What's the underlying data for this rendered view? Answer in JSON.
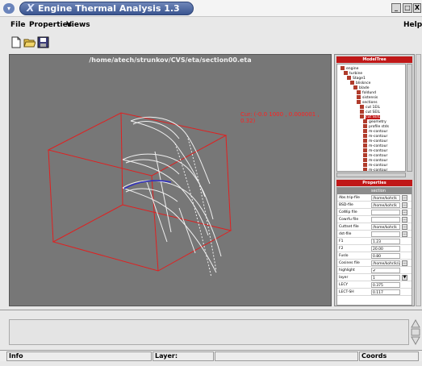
{
  "window": {
    "title": "Engine Thermal Analysis 1.3",
    "logo_glyph": "X",
    "controls": [
      "_",
      "□",
      "X"
    ]
  },
  "menu": {
    "file": "File",
    "properties": "Properties",
    "views": "Views",
    "help": "Help"
  },
  "toolbar": {
    "icons": [
      "new-file-icon",
      "open-folder-icon",
      "save-icon"
    ]
  },
  "viewport": {
    "path": "/home/atech/strunkov/CVS/eta/section00.eta",
    "coord_readout": "Cur: (-0.0 1000 , 0.000001  , 0.32)",
    "colors": {
      "background": "#777777",
      "box": "#e02020",
      "blade": "#f0f0f0",
      "highlight": "#3030c0"
    }
  },
  "model_tree": {
    "header": "ModelTree",
    "nodes": [
      {
        "label": "engine",
        "level": 0
      },
      {
        "label": "turbine",
        "level": 1
      },
      {
        "label": "Stage1",
        "level": 2
      },
      {
        "label": "blisknce",
        "level": 3
      },
      {
        "label": "blade",
        "level": 4
      },
      {
        "label": "foldund",
        "level": 5
      },
      {
        "label": "sistensis",
        "level": 5
      },
      {
        "label": "sections",
        "level": 5
      },
      {
        "label": "cut 1EIL",
        "level": 6
      },
      {
        "label": "cut SEIL",
        "level": 6
      },
      {
        "label": "cut SEIL",
        "level": 6,
        "selected": true
      },
      {
        "label": "geometry",
        "level": 7
      },
      {
        "label": "profile stds",
        "level": 7
      },
      {
        "label": "m-contour",
        "level": 7
      },
      {
        "label": "m-contour",
        "level": 7
      },
      {
        "label": "m-contour",
        "level": 7
      },
      {
        "label": "m-contour",
        "level": 7
      },
      {
        "label": "m-contour",
        "level": 7
      },
      {
        "label": "m-contour",
        "level": 7
      },
      {
        "label": "m-contour",
        "level": 7
      },
      {
        "label": "m-contour",
        "level": 7
      },
      {
        "label": "m-contour",
        "level": 7
      }
    ]
  },
  "properties": {
    "header": "Properties",
    "section": "section",
    "rows": [
      {
        "key": "Abs.trip-file",
        "value": "/home/kohr/k",
        "button": "..."
      },
      {
        "key": "BSD-file",
        "value": "/home/kohr/k",
        "button": "..."
      },
      {
        "key": "CoWip file",
        "value": "",
        "button": "..."
      },
      {
        "key": "Cowrfu file",
        "value": "",
        "button": "..."
      },
      {
        "key": "Cuttset file",
        "value": "/home/kohr/k",
        "button": "..."
      },
      {
        "key": "dst-file",
        "value": "",
        "button": "..."
      },
      {
        "key": "F1",
        "value": "1.23",
        "button": ""
      },
      {
        "key": "F2",
        "value": "20.00",
        "button": ""
      },
      {
        "key": "Fuslo",
        "value": "0.80",
        "button": ""
      },
      {
        "key": "Cosines file",
        "value": "/home/kohr/k/v",
        "button": "..."
      },
      {
        "key": "highlight",
        "value": "✔",
        "button": ""
      },
      {
        "key": "layer",
        "value": "1",
        "button": "▼"
      },
      {
        "key": "LECY",
        "value": "0.375",
        "button": ""
      },
      {
        "key": "LECT-SH",
        "value": "0.117",
        "button": ""
      }
    ]
  },
  "status": {
    "info": "Info",
    "layer": "Layer:",
    "coords": "Coords"
  }
}
